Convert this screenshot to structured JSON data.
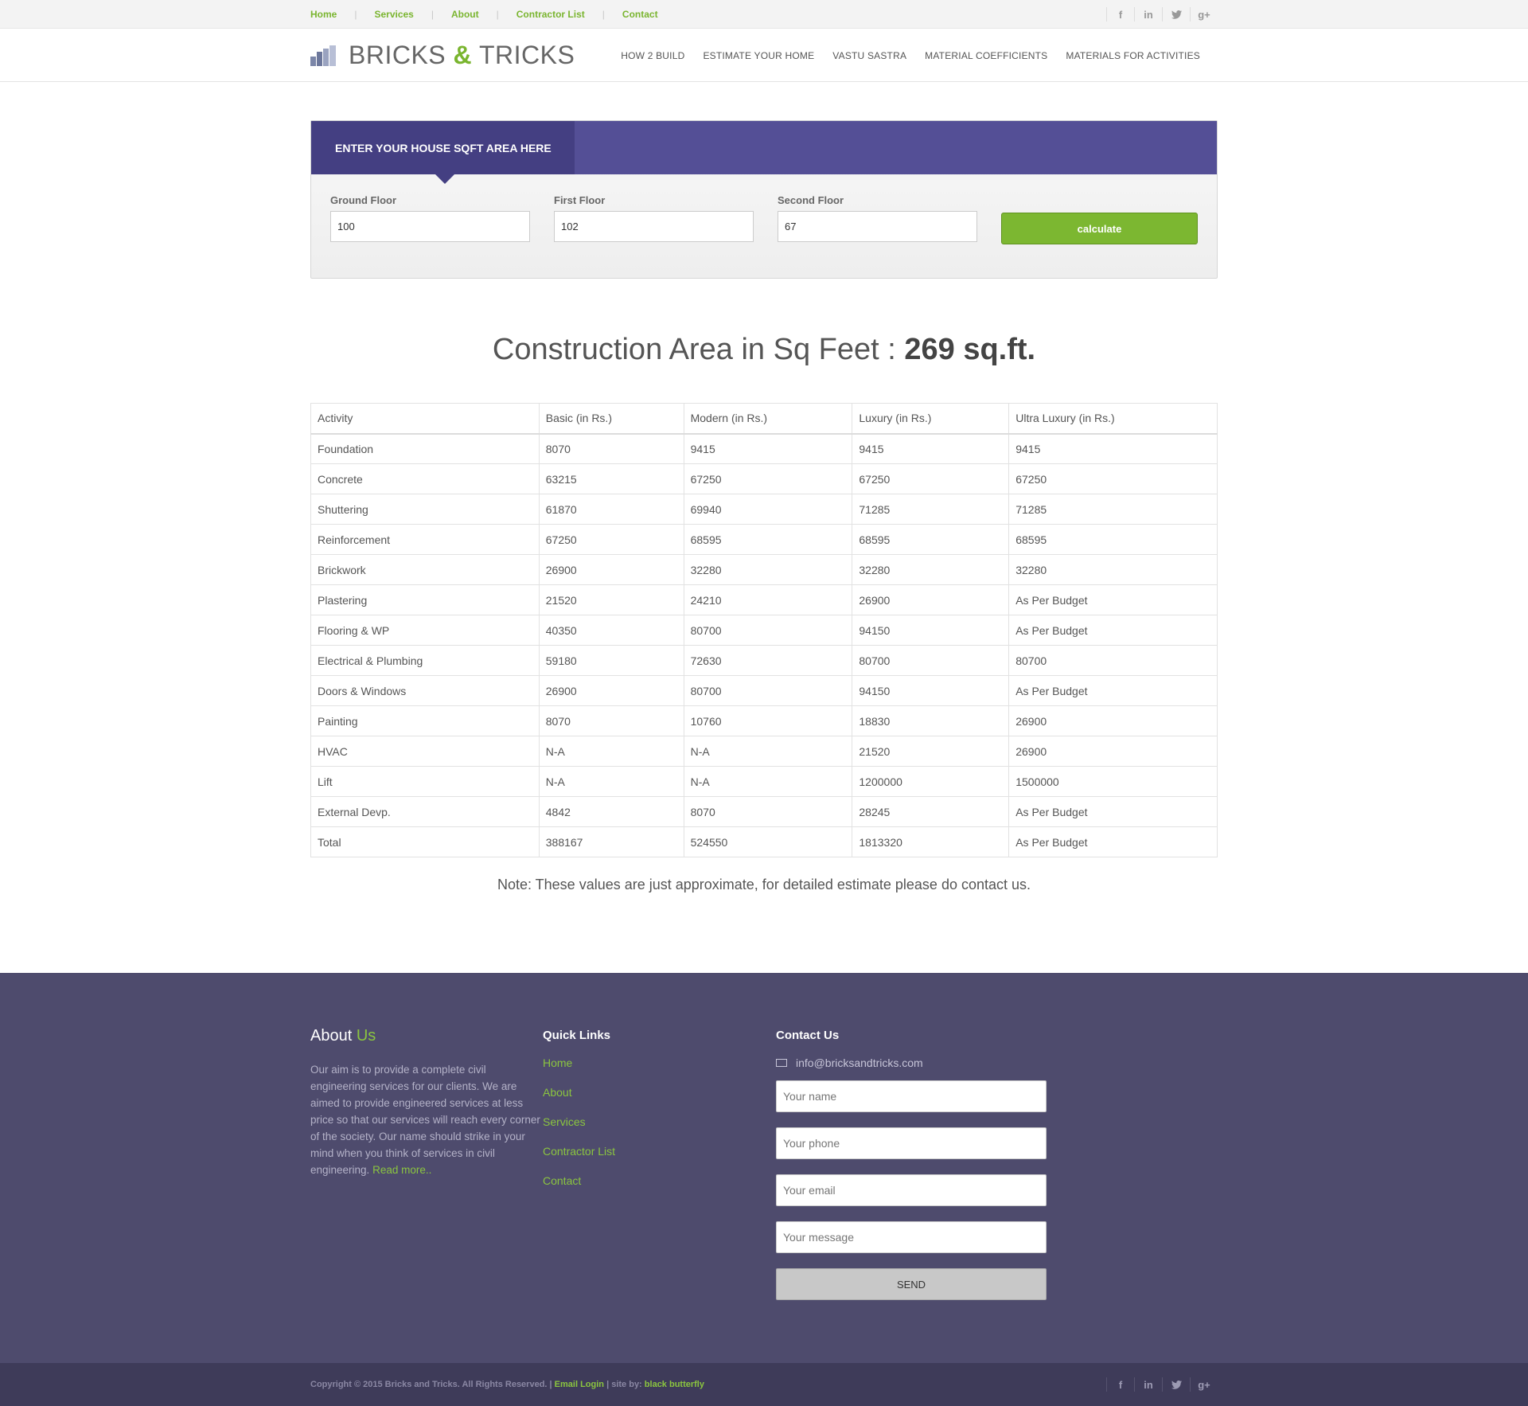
{
  "topbar": {
    "links": [
      "Home",
      "Services",
      "About",
      "Contractor List",
      "Contact"
    ],
    "social": [
      "f",
      "in",
      "t",
      "g+"
    ]
  },
  "header": {
    "logo_left": "BRICKS",
    "logo_amp": "&",
    "logo_right": "TRICKS",
    "nav": [
      "HOW 2 BUILD",
      "ESTIMATE YOUR HOME",
      "VASTU SASTRA",
      "MATERIAL COEFFICIENTS",
      "MATERIALS FOR ACTIVITIES"
    ]
  },
  "calculator": {
    "heading": "ENTER YOUR HOUSE SQFT AREA HERE",
    "ground_label": "Ground Floor",
    "ground_value": "100",
    "first_label": "First Floor",
    "first_value": "102",
    "second_label": "Second Floor",
    "second_value": "67",
    "button": "calculate"
  },
  "result": {
    "label": "Construction Area in Sq Feet :",
    "value": "269 sq.ft."
  },
  "table": {
    "headers": [
      "Activity",
      "Basic (in Rs.)",
      "Modern (in Rs.)",
      "Luxury (in Rs.)",
      "Ultra Luxury (in Rs.)"
    ],
    "rows": [
      [
        "Foundation",
        "8070",
        "9415",
        "9415",
        "9415"
      ],
      [
        "Concrete",
        "63215",
        "67250",
        "67250",
        "67250"
      ],
      [
        "Shuttering",
        "61870",
        "69940",
        "71285",
        "71285"
      ],
      [
        "Reinforcement",
        "67250",
        "68595",
        "68595",
        "68595"
      ],
      [
        "Brickwork",
        "26900",
        "32280",
        "32280",
        "32280"
      ],
      [
        "Plastering",
        "21520",
        "24210",
        "26900",
        "As Per Budget"
      ],
      [
        "Flooring & WP",
        "40350",
        "80700",
        "94150",
        "As Per Budget"
      ],
      [
        "Electrical & Plumbing",
        "59180",
        "72630",
        "80700",
        "80700"
      ],
      [
        "Doors & Windows",
        "26900",
        "80700",
        "94150",
        "As Per Budget"
      ],
      [
        "Painting",
        "8070",
        "10760",
        "18830",
        "26900"
      ],
      [
        "HVAC",
        "N-A",
        "N-A",
        "21520",
        "26900"
      ],
      [
        "Lift",
        "N-A",
        "N-A",
        "1200000",
        "1500000"
      ],
      [
        "External Devp.",
        "4842",
        "8070",
        "28245",
        "As Per Budget"
      ],
      [
        "Total",
        "388167",
        "524550",
        "1813320",
        "As Per Budget"
      ]
    ]
  },
  "note": "Note: These values are just approximate, for detailed estimate please do contact us.",
  "footer": {
    "about_title": "About",
    "about_title_hl": "Us",
    "about_text": "Our aim is to provide a complete civil engineering services for our clients. We are aimed to provide engineered services at less price so that our services will reach every corner of the society. Our name should strike in your mind when you think of services in civil engineering.",
    "read_more": "Read more..",
    "quick_links_title": "Quick Links",
    "quick_links": [
      "Home",
      "About",
      "Services",
      "Contractor List",
      "Contact"
    ],
    "contact_title": "Contact Us",
    "email": "info@bricksandtricks.com",
    "placeholders": {
      "name": "Your name",
      "phone": "Your phone",
      "email": "Your email",
      "message": "Your message"
    },
    "send": "SEND"
  },
  "bottombar": {
    "copyright": "Copyright © 2015 Bricks and Tricks. All Rights Reserved. |",
    "email_login": "Email Login",
    "site_by_prefix": "| site by:",
    "site_by": "black butterfly"
  },
  "colors": {
    "accent_green": "#7ab52f",
    "purple": "#544f96",
    "purple_dark": "#443f82",
    "footer_bg": "#4e4b6d"
  }
}
